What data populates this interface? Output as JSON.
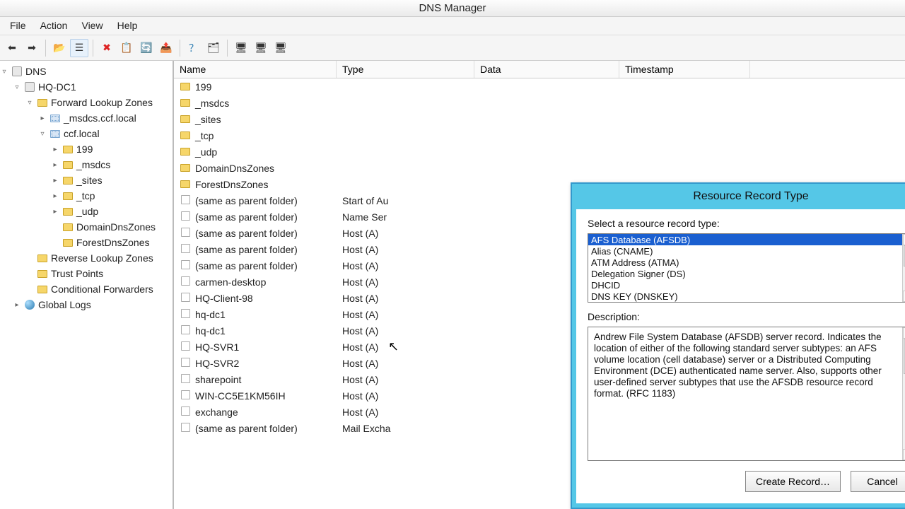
{
  "title": "DNS Manager",
  "menu": [
    "File",
    "Action",
    "View",
    "Help"
  ],
  "tree": [
    {
      "indent": 0,
      "toggle": "▿",
      "icon": "server",
      "label": "DNS"
    },
    {
      "indent": 1,
      "toggle": "▿",
      "icon": "server",
      "label": "HQ-DC1"
    },
    {
      "indent": 2,
      "toggle": "▿",
      "icon": "folder",
      "label": "Forward Lookup Zones"
    },
    {
      "indent": 3,
      "toggle": "▸",
      "icon": "folder-blue",
      "label": "_msdcs.ccf.local"
    },
    {
      "indent": 3,
      "toggle": "▿",
      "icon": "folder-blue",
      "label": "ccf.local",
      "selected": false
    },
    {
      "indent": 4,
      "toggle": "▸",
      "icon": "folder",
      "label": "199"
    },
    {
      "indent": 4,
      "toggle": "▸",
      "icon": "folder",
      "label": "_msdcs"
    },
    {
      "indent": 4,
      "toggle": "▸",
      "icon": "folder",
      "label": "_sites"
    },
    {
      "indent": 4,
      "toggle": "▸",
      "icon": "folder",
      "label": "_tcp"
    },
    {
      "indent": 4,
      "toggle": "▸",
      "icon": "folder",
      "label": "_udp"
    },
    {
      "indent": 4,
      "toggle": "",
      "icon": "folder",
      "label": "DomainDnsZones"
    },
    {
      "indent": 4,
      "toggle": "",
      "icon": "folder",
      "label": "ForestDnsZones"
    },
    {
      "indent": 2,
      "toggle": "",
      "icon": "folder",
      "label": "Reverse Lookup Zones"
    },
    {
      "indent": 2,
      "toggle": "",
      "icon": "folder",
      "label": "Trust Points"
    },
    {
      "indent": 2,
      "toggle": "",
      "icon": "folder",
      "label": "Conditional Forwarders"
    },
    {
      "indent": 1,
      "toggle": "▸",
      "icon": "globe",
      "label": "Global Logs"
    }
  ],
  "list_columns": [
    "Name",
    "Type",
    "Data",
    "Timestamp"
  ],
  "list_rows": [
    {
      "icon": "folder",
      "name": "199",
      "type": "",
      "data": "",
      "ts": ""
    },
    {
      "icon": "folder",
      "name": "_msdcs",
      "type": "",
      "data": "",
      "ts": ""
    },
    {
      "icon": "folder",
      "name": "_sites",
      "type": "",
      "data": "",
      "ts": ""
    },
    {
      "icon": "folder",
      "name": "_tcp",
      "type": "",
      "data": "",
      "ts": ""
    },
    {
      "icon": "folder",
      "name": "_udp",
      "type": "",
      "data": "",
      "ts": ""
    },
    {
      "icon": "folder",
      "name": "DomainDnsZones",
      "type": "",
      "data": "",
      "ts": ""
    },
    {
      "icon": "folder",
      "name": "ForestDnsZones",
      "type": "",
      "data": "",
      "ts": ""
    },
    {
      "icon": "rec",
      "name": "(same as parent folder)",
      "type": "Start of Au",
      "data": "",
      "ts": ""
    },
    {
      "icon": "rec",
      "name": "(same as parent folder)",
      "type": "Name Ser",
      "data": "",
      "ts": ""
    },
    {
      "icon": "rec",
      "name": "(same as parent folder)",
      "type": "Host (A)",
      "data": "",
      "ts": ""
    },
    {
      "icon": "rec",
      "name": "(same as parent folder)",
      "type": "Host (A)",
      "data": "",
      "ts": ""
    },
    {
      "icon": "rec",
      "name": "(same as parent folder)",
      "type": "Host (A)",
      "data": "",
      "ts": ""
    },
    {
      "icon": "rec",
      "name": "carmen-desktop",
      "type": "Host (A)",
      "data": "",
      "ts": ""
    },
    {
      "icon": "rec",
      "name": "HQ-Client-98",
      "type": "Host (A)",
      "data": "",
      "ts": ""
    },
    {
      "icon": "rec",
      "name": "hq-dc1",
      "type": "Host (A)",
      "data": "",
      "ts": ""
    },
    {
      "icon": "rec",
      "name": "hq-dc1",
      "type": "Host (A)",
      "data": "",
      "ts": ""
    },
    {
      "icon": "rec",
      "name": "HQ-SVR1",
      "type": "Host (A)",
      "data": "",
      "ts": ""
    },
    {
      "icon": "rec",
      "name": "HQ-SVR2",
      "type": "Host (A)",
      "data": "",
      "ts": ""
    },
    {
      "icon": "rec",
      "name": "sharepoint",
      "type": "Host (A)",
      "data": "",
      "ts": ""
    },
    {
      "icon": "rec",
      "name": "WIN-CC5E1KM56IH",
      "type": "Host (A)",
      "data": "",
      "ts": ""
    },
    {
      "icon": "rec",
      "name": "exchange",
      "type": "Host (A)",
      "data": "",
      "ts": ""
    },
    {
      "icon": "rec",
      "name": "(same as parent folder)",
      "type": "Mail Excha",
      "data": "",
      "ts": ""
    }
  ],
  "dialog": {
    "title": "Resource Record Type",
    "select_label": "Select a resource record type:",
    "types": [
      {
        "label": "AFS Database (AFSDB)",
        "selected": true
      },
      {
        "label": "Alias (CNAME)"
      },
      {
        "label": "ATM Address (ATMA)"
      },
      {
        "label": "Delegation Signer (DS)"
      },
      {
        "label": "DHCID"
      },
      {
        "label": "DNS KEY (DNSKEY)"
      }
    ],
    "desc_label": "Description:",
    "description": "Andrew File System Database (AFSDB) server record. Indicates the location of either of the following standard server subtypes: an AFS volume location (cell database) server or a Distributed Computing Environment (DCE) authenticated name server. Also, supports other user-defined server subtypes that use the AFSDB resource record format. (RFC 1183)",
    "create_btn": "Create Record…",
    "cancel_btn": "Cancel"
  }
}
